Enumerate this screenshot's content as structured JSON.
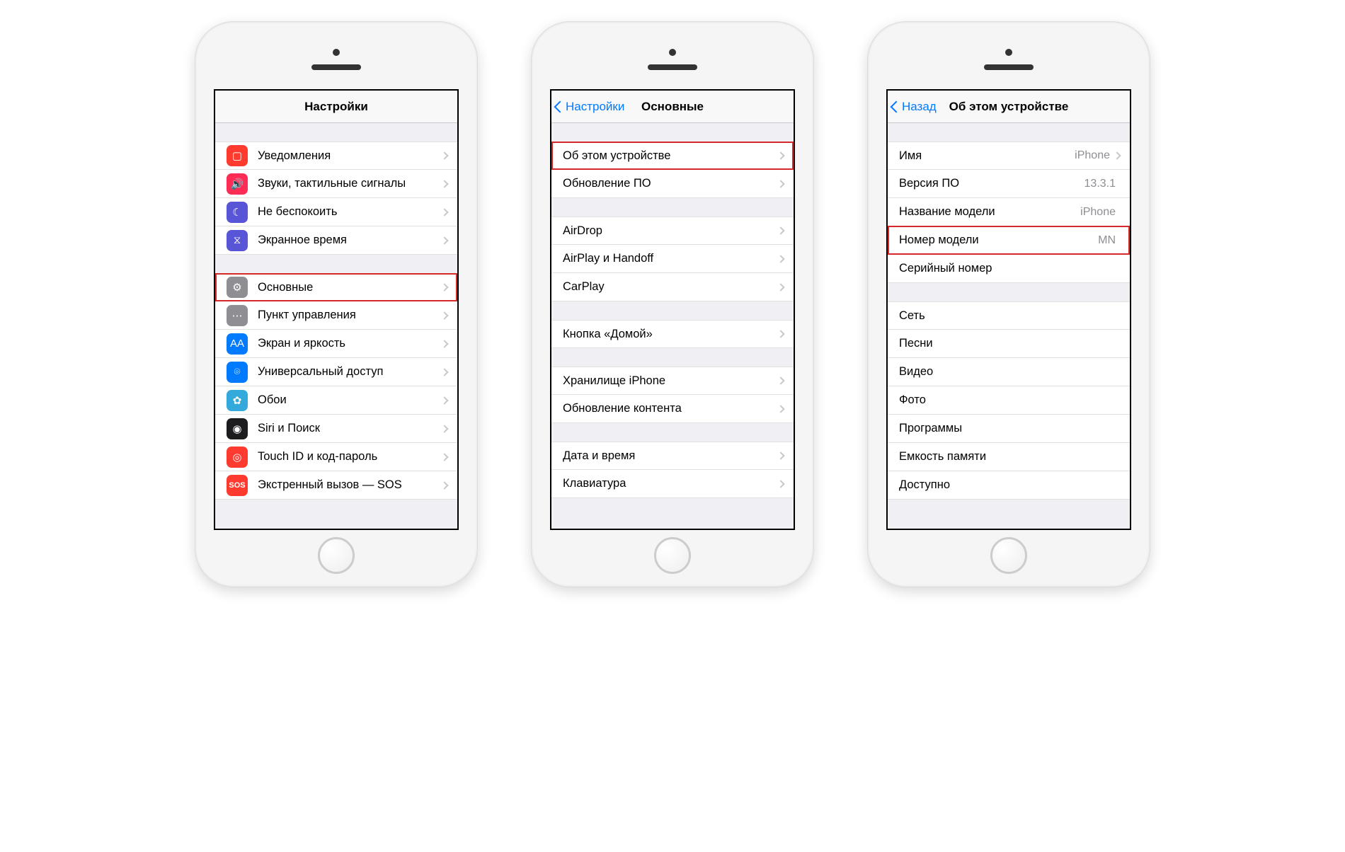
{
  "phone1": {
    "title": "Настройки",
    "rows_a": [
      {
        "id": "notifications",
        "label": "Уведомления",
        "icon": "ic-notif",
        "glyph": "▢"
      },
      {
        "id": "sounds",
        "label": "Звуки, тактильные сигналы",
        "icon": "ic-sound",
        "glyph": "🔊"
      },
      {
        "id": "dnd",
        "label": "Не беспокоить",
        "icon": "ic-dnd",
        "glyph": "☾"
      },
      {
        "id": "screentime",
        "label": "Экранное время",
        "icon": "ic-screentime",
        "glyph": "⧖"
      }
    ],
    "rows_b": [
      {
        "id": "general",
        "label": "Основные",
        "icon": "ic-general",
        "glyph": "⚙",
        "highlight": true
      },
      {
        "id": "control",
        "label": "Пункт управления",
        "icon": "ic-control",
        "glyph": "⋯"
      },
      {
        "id": "display",
        "label": "Экран и яркость",
        "icon": "ic-display",
        "glyph": "AA"
      },
      {
        "id": "accessibility",
        "label": "Универсальный доступ",
        "icon": "ic-access",
        "glyph": "⌾"
      },
      {
        "id": "wallpaper",
        "label": "Обои",
        "icon": "ic-wallpaper",
        "glyph": "✿"
      },
      {
        "id": "siri",
        "label": "Siri и Поиск",
        "icon": "ic-siri",
        "glyph": "◉"
      },
      {
        "id": "touchid",
        "label": "Touch ID и код-пароль",
        "icon": "ic-touchid",
        "glyph": "◎"
      },
      {
        "id": "sos",
        "label": "Экстренный вызов — SOS",
        "icon": "ic-sos",
        "glyph": "SOS"
      }
    ]
  },
  "phone2": {
    "back": "Настройки",
    "title": "Основные",
    "g1": [
      {
        "id": "about",
        "label": "Об этом устройстве",
        "highlight": true
      },
      {
        "id": "update",
        "label": "Обновление ПО"
      }
    ],
    "g2": [
      {
        "id": "airdrop",
        "label": "AirDrop"
      },
      {
        "id": "airplay",
        "label": "AirPlay и Handoff"
      },
      {
        "id": "carplay",
        "label": "CarPlay"
      }
    ],
    "g3": [
      {
        "id": "homebtn",
        "label": "Кнопка «Домой»"
      }
    ],
    "g4": [
      {
        "id": "storage",
        "label": "Хранилище iPhone"
      },
      {
        "id": "bgrefresh",
        "label": "Обновление контента"
      }
    ],
    "g5": [
      {
        "id": "datetime",
        "label": "Дата и время"
      },
      {
        "id": "keyboard",
        "label": "Клавиатура"
      }
    ]
  },
  "phone3": {
    "back": "Назад",
    "title": "Об этом устройстве",
    "g1": [
      {
        "id": "name",
        "label": "Имя",
        "value": "iPhone",
        "chev": true
      },
      {
        "id": "version",
        "label": "Версия ПО",
        "value": "13.3.1"
      },
      {
        "id": "modelname",
        "label": "Название модели",
        "value": "iPhone"
      },
      {
        "id": "modelnum",
        "label": "Номер модели",
        "value": "MN",
        "highlight": true
      },
      {
        "id": "serial",
        "label": "Серийный номер",
        "value": ""
      }
    ],
    "g2": [
      {
        "id": "network",
        "label": "Сеть"
      },
      {
        "id": "songs",
        "label": "Песни"
      },
      {
        "id": "videos",
        "label": "Видео"
      },
      {
        "id": "photos",
        "label": "Фото"
      },
      {
        "id": "apps",
        "label": "Программы"
      },
      {
        "id": "capacity",
        "label": "Емкость памяти"
      },
      {
        "id": "available",
        "label": "Доступно"
      }
    ]
  }
}
